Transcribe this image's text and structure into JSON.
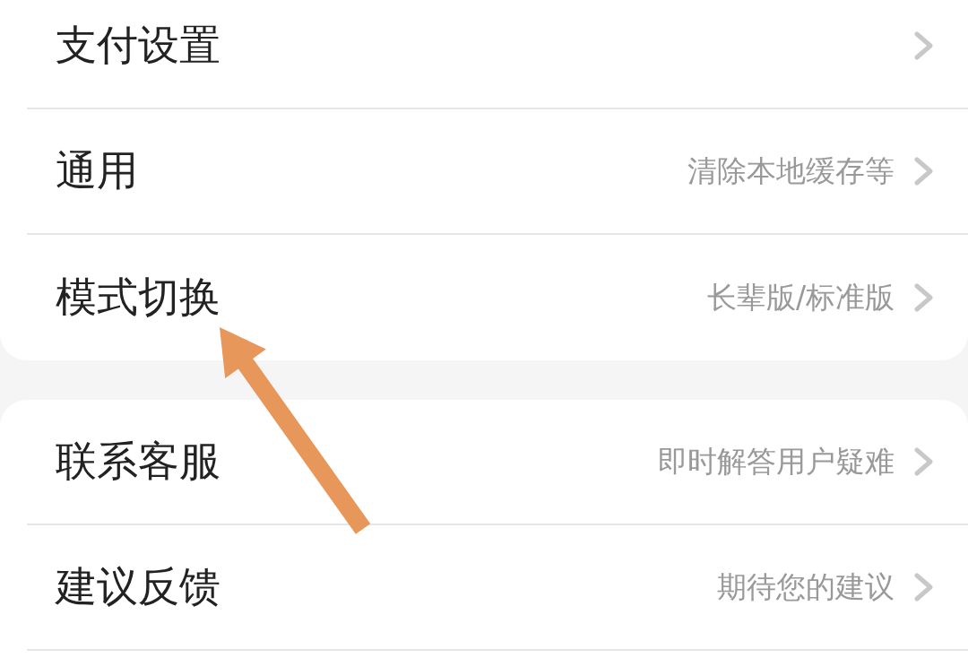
{
  "groups": [
    {
      "items": [
        {
          "label": "支付设置"
        },
        {
          "label": "通用",
          "hint": "清除本地缓存等"
        },
        {
          "label": "模式切换",
          "hint": "长辈版/标准版"
        }
      ]
    },
    {
      "items": [
        {
          "label": "联系客服",
          "hint": "即时解答用户疑难"
        },
        {
          "label": "建议反馈",
          "hint": "期待您的建议"
        }
      ]
    }
  ]
}
